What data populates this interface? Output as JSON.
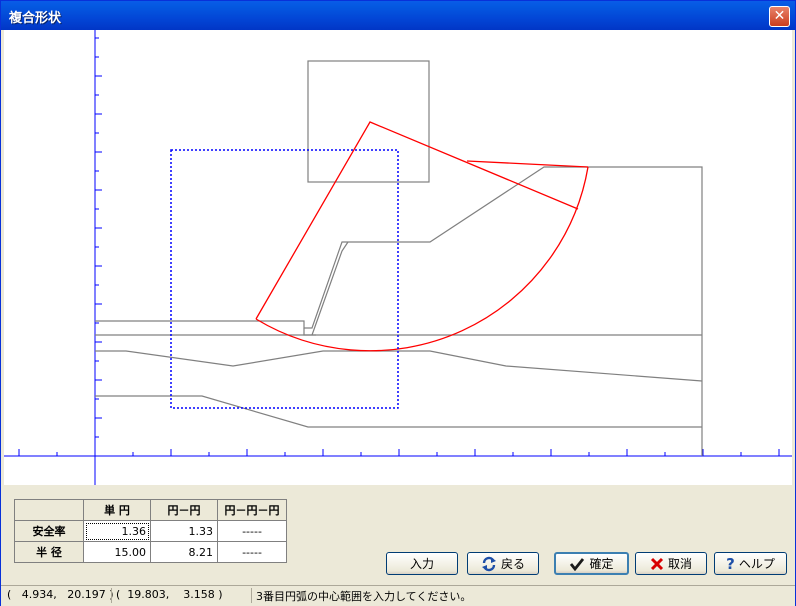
{
  "window": {
    "title": "複合形状",
    "close_glyph": "✕"
  },
  "table": {
    "headers": [
      "単 円",
      "円－円",
      "円－円－円"
    ],
    "rows": [
      {
        "label": "安全率",
        "values": [
          "1.36",
          "1.33",
          "-----"
        ]
      },
      {
        "label": "半 径",
        "values": [
          "15.00",
          "8.21",
          "-----"
        ]
      }
    ]
  },
  "buttons": {
    "input": "入力",
    "back": "戻る",
    "confirm": "確定",
    "cancel": "取消",
    "help": "ヘルプ"
  },
  "icons": {
    "back": "refresh-arrows-icon",
    "confirm": "checkmark-icon",
    "cancel": "x-icon",
    "help": "question-mark-icon"
  },
  "colors": {
    "slip_circle": "#ff0000",
    "center_range": "#0000ff",
    "strata": "#808080",
    "axes": "#0000ff"
  },
  "status": {
    "coord1": "(   4.934,   20.197 )",
    "coord2": "(  19.803,    3.158 )",
    "message": "3番目円弧の中心範囲を入力してください。"
  }
}
